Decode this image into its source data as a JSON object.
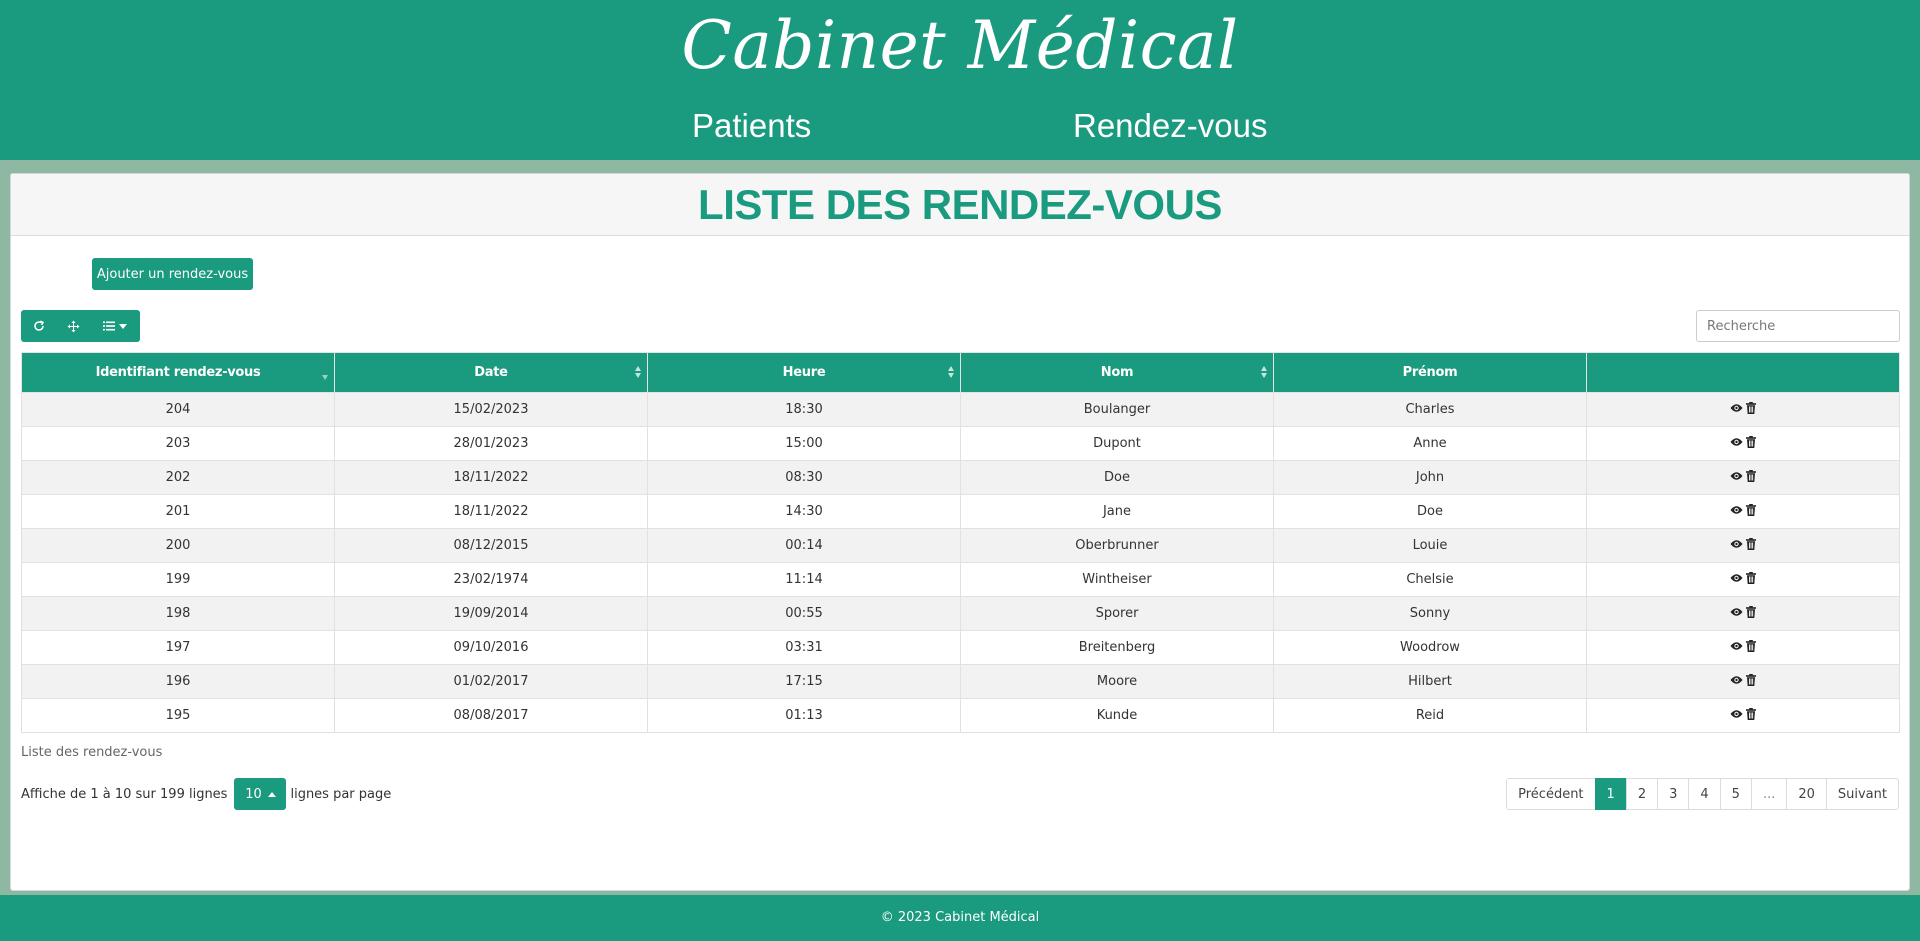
{
  "header": {
    "brand": "Cabinet Médical",
    "nav": [
      {
        "label": "Patients"
      },
      {
        "label": "Rendez-vous"
      }
    ]
  },
  "page": {
    "title": "LISTE DES RENDEZ-VOUS",
    "add_button": "Ajouter un rendez-vous"
  },
  "toolbar": {
    "icons": [
      "refresh-icon",
      "move-icon",
      "columns-list-icon"
    ]
  },
  "search": {
    "placeholder": "Recherche",
    "value": ""
  },
  "table": {
    "columns": [
      "Identifiant rendez-vous",
      "Date",
      "Heure",
      "Nom",
      "Prénom",
      ""
    ],
    "rows": [
      [
        "204",
        "15/02/2023",
        "18:30",
        "Boulanger",
        "Charles"
      ],
      [
        "203",
        "28/01/2023",
        "15:00",
        "Dupont",
        "Anne"
      ],
      [
        "202",
        "18/11/2022",
        "08:30",
        "Doe",
        "John"
      ],
      [
        "201",
        "18/11/2022",
        "14:30",
        "Jane",
        "Doe"
      ],
      [
        "200",
        "08/12/2015",
        "00:14",
        "Oberbrunner",
        "Louie"
      ],
      [
        "199",
        "23/02/1974",
        "11:14",
        "Wintheiser",
        "Chelsie"
      ],
      [
        "198",
        "19/09/2014",
        "00:55",
        "Sporer",
        "Sonny"
      ],
      [
        "197",
        "09/10/2016",
        "03:31",
        "Breitenberg",
        "Woodrow"
      ],
      [
        "196",
        "01/02/2017",
        "17:15",
        "Moore",
        "Hilbert"
      ],
      [
        "195",
        "08/08/2017",
        "01:13",
        "Kunde",
        "Reid"
      ]
    ],
    "row_actions": [
      "eye-icon",
      "trash-icon"
    ],
    "caption": "Liste des rendez-vous"
  },
  "pagination": {
    "info": "Affiche de 1 à 10 sur 199 lignes",
    "page_size": "10",
    "per_page_label": "lignes par page",
    "prev": "Précédent",
    "pages": [
      "1",
      "2",
      "3",
      "4",
      "5",
      "...",
      "20"
    ],
    "active_page": "1",
    "next": "Suivant"
  },
  "footer": {
    "text": "© 2023 Cabinet Médical"
  },
  "colors": {
    "primary": "#1a9a7e",
    "page_bg": "#8fb8a3",
    "stripe": "#f2f2f2"
  }
}
